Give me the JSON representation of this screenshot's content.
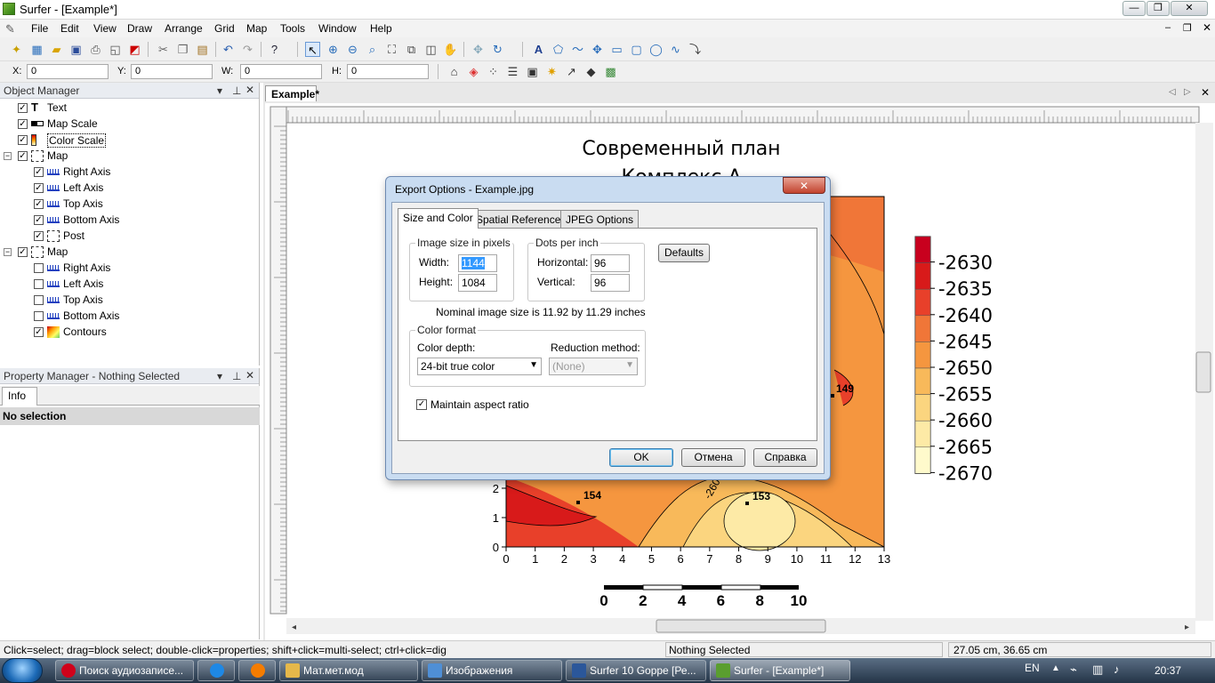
{
  "window": {
    "title": "Surfer - [Example*]",
    "minimize": "—",
    "maximize": "❐",
    "close": "✕"
  },
  "menu": [
    "File",
    "Edit",
    "View",
    "Draw",
    "Arrange",
    "Grid",
    "Map",
    "Tools",
    "Window",
    "Help"
  ],
  "coords": {
    "x_label": "X:",
    "x_value": "0",
    "y_label": "Y:",
    "y_value": "0",
    "w_label": "W:",
    "w_value": "0",
    "h_label": "H:",
    "h_value": "0"
  },
  "object_manager": {
    "title": "Object Manager",
    "items": [
      {
        "label": "Text",
        "checked": true,
        "level": 1,
        "icon": "text-icon"
      },
      {
        "label": "Map Scale",
        "checked": true,
        "level": 1,
        "icon": "map-scale-icon"
      },
      {
        "label": "Color Scale",
        "checked": true,
        "level": 1,
        "icon": "color-scale-icon"
      },
      {
        "label": "Map",
        "checked": true,
        "level": 0,
        "icon": "map-icon"
      },
      {
        "label": "Right Axis",
        "checked": true,
        "level": 2,
        "icon": "axis-icon"
      },
      {
        "label": "Left Axis",
        "checked": true,
        "level": 2,
        "icon": "axis-icon"
      },
      {
        "label": "Top Axis",
        "checked": true,
        "level": 2,
        "icon": "axis-icon"
      },
      {
        "label": "Bottom Axis",
        "checked": true,
        "level": 2,
        "icon": "axis-icon"
      },
      {
        "label": "Post",
        "checked": true,
        "level": 2,
        "icon": "post-icon"
      },
      {
        "label": "Map",
        "checked": true,
        "level": 0,
        "icon": "map-icon"
      },
      {
        "label": "Right Axis",
        "checked": false,
        "level": 2,
        "icon": "axis-icon"
      },
      {
        "label": "Left Axis",
        "checked": false,
        "level": 2,
        "icon": "axis-icon"
      },
      {
        "label": "Top Axis",
        "checked": false,
        "level": 2,
        "icon": "axis-icon"
      },
      {
        "label": "Bottom Axis",
        "checked": false,
        "level": 2,
        "icon": "axis-icon"
      },
      {
        "label": "Contours",
        "checked": true,
        "level": 2,
        "icon": "contours-icon"
      }
    ]
  },
  "property_manager": {
    "title": "Property Manager - Nothing Selected",
    "tab": "Info",
    "content": "No selection"
  },
  "doc_tab": "Example*",
  "plot": {
    "title_line1": "Современный план",
    "title_line2": "Комплекс А",
    "x_ticks": [
      "0",
      "1",
      "2",
      "3",
      "4",
      "5",
      "6",
      "7",
      "8",
      "9",
      "10",
      "11",
      "12",
      "13"
    ],
    "y_ticks": [
      "0",
      "1",
      "2"
    ],
    "posts": [
      {
        "label": "154"
      },
      {
        "label": "153"
      },
      {
        "label": "149"
      }
    ],
    "contour_label": "-260",
    "contour_label2": "5",
    "scale_bar_ticks": [
      "0",
      "2",
      "4",
      "6",
      "8",
      "10"
    ],
    "legend": [
      {
        "value": "-2630",
        "color": "#c8001e"
      },
      {
        "value": "-2635",
        "color": "#d81a1a"
      },
      {
        "value": "-2640",
        "color": "#e8402a"
      },
      {
        "value": "-2645",
        "color": "#f07638"
      },
      {
        "value": "-2650",
        "color": "#f5963f"
      },
      {
        "value": "-2655",
        "color": "#f8b95a"
      },
      {
        "value": "-2660",
        "color": "#fbd57f"
      },
      {
        "value": "-2665",
        "color": "#fdeaa6"
      },
      {
        "value": "-2670",
        "color": "#fffacc"
      }
    ]
  },
  "dialog": {
    "title": "Export Options - Example.jpg",
    "close": "✕",
    "tabs": [
      "Size and Color",
      "Spatial References",
      "JPEG Options"
    ],
    "size_group": "Image size in pixels",
    "width_label": "Width:",
    "width_value": "1144",
    "height_label": "Height:",
    "height_value": "1084",
    "dpi_group": "Dots per inch",
    "horizontal_label": "Horizontal:",
    "horizontal_value": "96",
    "vertical_label": "Vertical:",
    "vertical_value": "96",
    "defaults": "Defaults",
    "nominal": "Nominal image size is 11.92 by 11.29 inches",
    "color_group": "Color format",
    "depth_label": "Color depth:",
    "depth_value": "24-bit true color",
    "reduction_label": "Reduction method:",
    "reduction_value": "(None)",
    "aspect_label": "Maintain aspect ratio",
    "aspect_checked": true,
    "ok": "OK",
    "cancel": "Отмена",
    "help": "Справка"
  },
  "status": {
    "hint": "Click=select; drag=block select; double-click=properties; shift+click=multi-select; ctrl+click=dig",
    "selection": "Nothing Selected",
    "position": "27.05 cm, 36.65 cm"
  },
  "taskbar": {
    "items": [
      {
        "label": "Поиск аудиозаписе...",
        "color": "#d0021b"
      },
      {
        "label": "",
        "color": "#1e88e5"
      },
      {
        "label": "",
        "color": "#f57c00"
      },
      {
        "label": "Мат.мет.мод",
        "color": "#e6b84a"
      },
      {
        "label": "Изображения",
        "color": "#4f8fd6"
      },
      {
        "label": "Surfer 10 Goppe [Ре...",
        "color": "#2b579a"
      },
      {
        "label": "Surfer - [Example*]",
        "color": "#5a9e2f"
      }
    ],
    "lang": "EN",
    "clock": "20:37"
  }
}
